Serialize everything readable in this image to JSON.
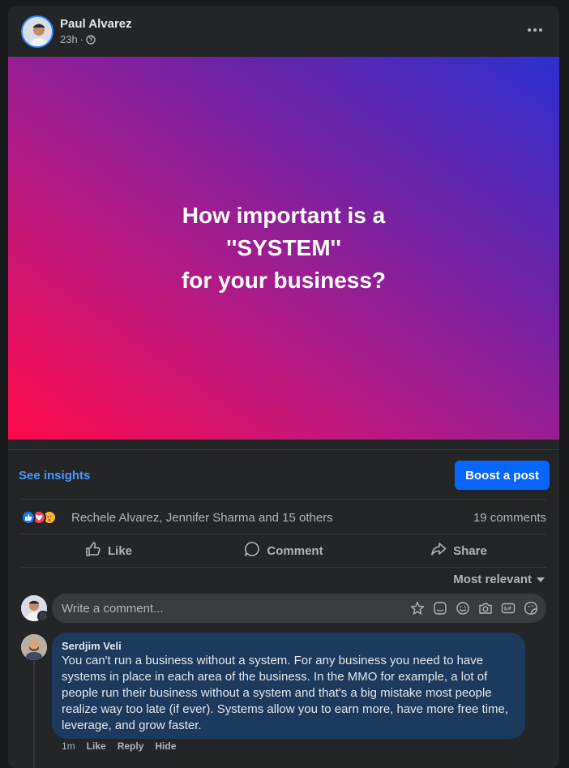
{
  "post": {
    "author": "Paul Alvarez",
    "time": "23h",
    "separator": "·",
    "banner_lines": [
      "How important is a",
      "''SYSTEM''",
      "for your business?"
    ]
  },
  "insights": {
    "see_insights": "See insights",
    "boost_label": "Boost a post"
  },
  "reactions": {
    "names": "Rechele Alvarez, Jennifer Sharma and 15 others",
    "comments": "19 comments"
  },
  "actions": {
    "like": "Like",
    "comment": "Comment",
    "share": "Share"
  },
  "sort": {
    "label": "Most relevant"
  },
  "composer": {
    "placeholder": "Write a comment..."
  },
  "comment": {
    "name": "Serdjim Veli",
    "text": "You can't run a business without a system. For any business you need to have systems in place in each area of the business. In the MMO for example, a lot of people run their business without a system and that's a big mistake most people realize way too late (if ever). Systems allow you to earn more, have more free time, leverage, and grow faster.",
    "time": "1m",
    "like": "Like",
    "reply": "Reply",
    "hide": "Hide"
  },
  "colors": {
    "accent": "#0866ff",
    "link": "#4599ff",
    "bubble": "#1c3a5e",
    "card": "#242526"
  },
  "icons": [
    "globe-icon",
    "more-icon",
    "like-icon",
    "comment-icon",
    "share-icon",
    "avatar-sticker-icon",
    "sticker-icon",
    "emoji-icon",
    "camera-icon",
    "gif-icon",
    "face-sticker-icon"
  ]
}
